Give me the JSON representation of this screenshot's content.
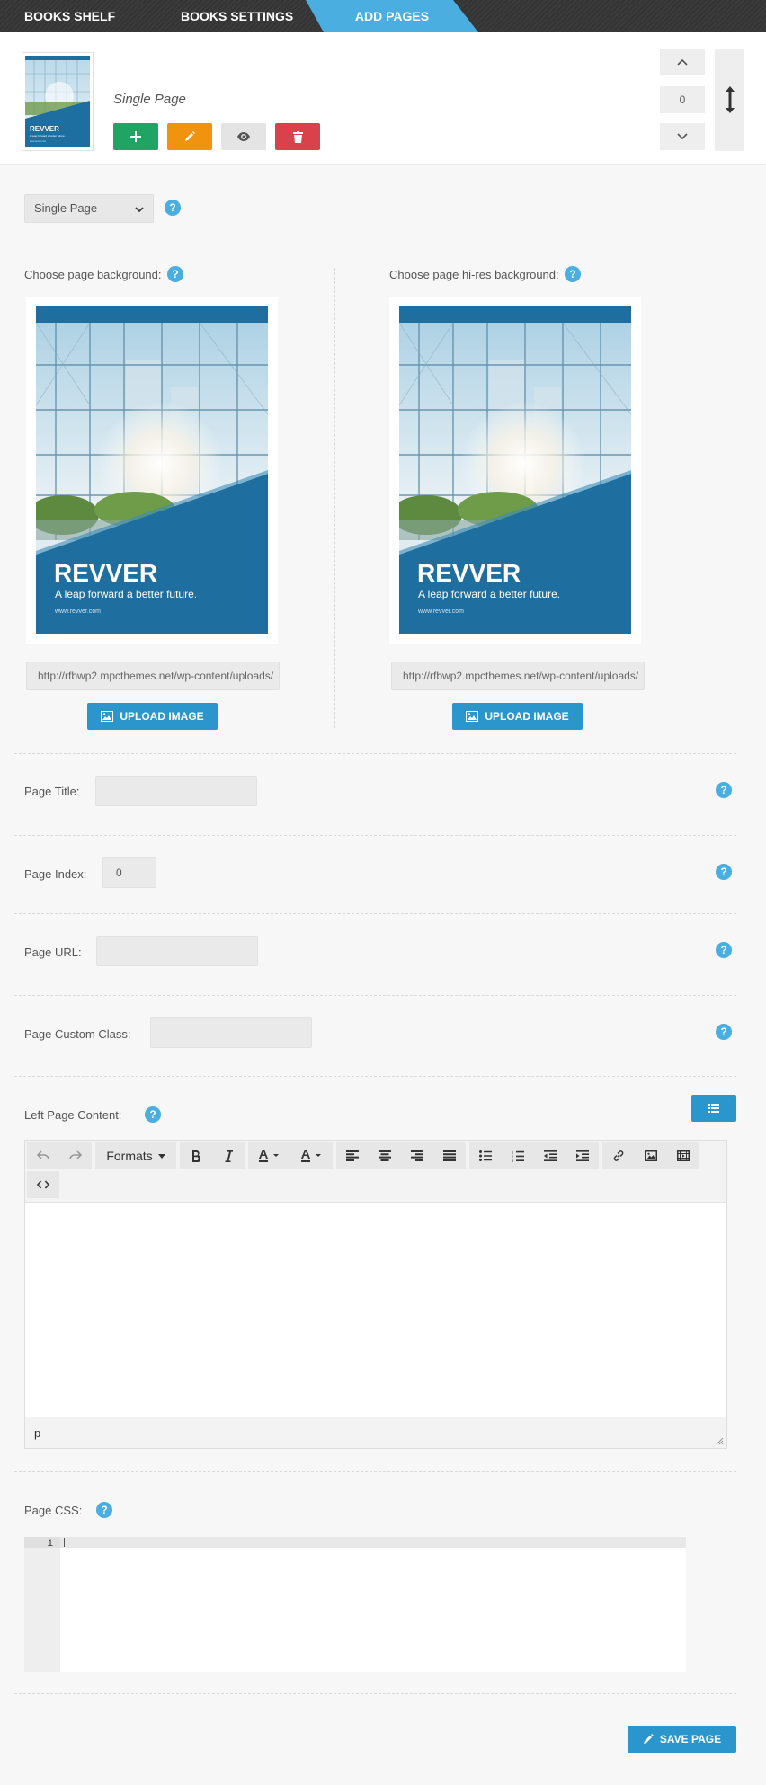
{
  "tabs": [
    {
      "label": "BOOKS SHELF"
    },
    {
      "label": "BOOKS SETTINGS"
    },
    {
      "label": "ADD PAGES"
    }
  ],
  "page_header": {
    "page_name": "Single Page",
    "order_value": "0",
    "cover_thumb": {
      "brand": "REVVER",
      "tagline": "A leap forward a better future.",
      "site": "www.revver.com"
    }
  },
  "page_type": {
    "selected": "Single Page"
  },
  "backgrounds": {
    "left": {
      "label": "Choose page background:",
      "url": "http://rfbwp2.mpcthemes.net/wp-content/uploads/",
      "button": "UPLOAD IMAGE"
    },
    "right": {
      "label": "Choose page hi-res background:",
      "url": "http://rfbwp2.mpcthemes.net/wp-content/uploads/",
      "button": "UPLOAD IMAGE"
    },
    "poster": {
      "brand": "REVVER",
      "tagline": "A leap forward a better future.",
      "site": "www.revver.com"
    }
  },
  "fields": {
    "title": {
      "label": "Page Title:",
      "value": ""
    },
    "index": {
      "label": "Page Index:",
      "value": "0"
    },
    "url": {
      "label": "Page URL:",
      "value": ""
    },
    "custom_class": {
      "label": "Page Custom Class:",
      "value": ""
    }
  },
  "editor": {
    "label": "Left Page Content:",
    "formats_label": "Formats",
    "status_path": "p"
  },
  "css_editor": {
    "label": "Page CSS:",
    "line_number": "1"
  },
  "help_icon_text": "?",
  "save_button": "SAVE PAGE",
  "colors": {
    "accent": "#4aaee0",
    "button_blue": "#2b96cc",
    "add_green": "#1fa463",
    "edit_orange": "#f0930f",
    "delete_red": "#d9424b",
    "poster_blue": "#1e6f9f"
  }
}
